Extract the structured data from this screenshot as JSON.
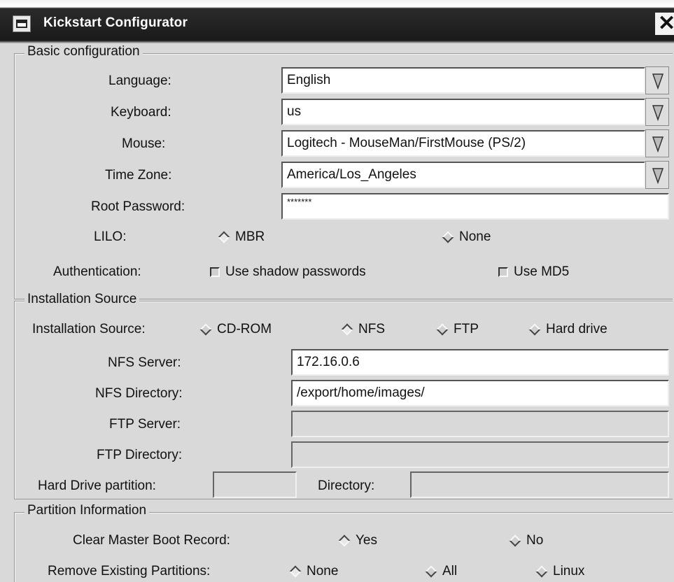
{
  "window": {
    "title": "Kickstart Configurator",
    "menu_icon": "window-menu-icon",
    "close_glyph": "✕"
  },
  "basic": {
    "title": "Basic configuration",
    "language_label": "Language:",
    "language_value": "English",
    "keyboard_label": "Keyboard:",
    "keyboard_value": "us",
    "mouse_label": "Mouse:",
    "mouse_value": "Logitech - MouseMan/FirstMouse (PS/2)",
    "timezone_label": "Time Zone:",
    "timezone_value": "America/Los_Angeles",
    "root_password_label": "Root Password:",
    "root_password_value": "*******",
    "lilo_label": "LILO:",
    "lilo_options": [
      "MBR",
      "None"
    ],
    "lilo_selected": "MBR",
    "auth_label": "Authentication:",
    "auth_shadow": "Use shadow passwords",
    "auth_md5": "Use MD5",
    "auth_shadow_checked": false,
    "auth_md5_checked": false
  },
  "install": {
    "title": "Installation Source",
    "source_label": "Installation Source:",
    "source_options": [
      "CD-ROM",
      "NFS",
      "FTP",
      "Hard drive"
    ],
    "source_selected": "NFS",
    "nfs_server_label": "NFS Server:",
    "nfs_server_value": "172.16.0.6",
    "nfs_dir_label": "NFS Directory:",
    "nfs_dir_value": "/export/home/images/",
    "ftp_server_label": "FTP Server:",
    "ftp_server_value": "",
    "ftp_dir_label": "FTP Directory:",
    "ftp_dir_value": "",
    "hd_partition_label": "Hard Drive partition:",
    "hd_partition_value": "",
    "hd_dir_label": "Directory:",
    "hd_dir_value": ""
  },
  "partition": {
    "title": "Partition Information",
    "clear_mbr_label": "Clear Master Boot Record:",
    "clear_mbr_options": [
      "Yes",
      "No"
    ],
    "clear_mbr_selected": "Yes",
    "remove_label": "Remove Existing Partitions:",
    "remove_options": [
      "None",
      "All",
      "Linux"
    ],
    "remove_selected": "None"
  },
  "colors": {
    "titlebar": "#1a1a1a",
    "background": "#d9d9d9",
    "field": "#ffffff"
  }
}
